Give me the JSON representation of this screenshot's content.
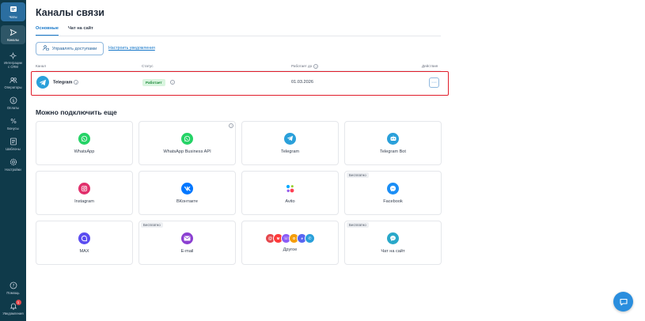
{
  "sidebar": {
    "items": [
      {
        "label": "Чаты",
        "icon": "chat-icon"
      },
      {
        "label": "Каналы",
        "icon": "send-icon"
      },
      {
        "label": "Интеграции\nс CRM",
        "icon": "integration-icon"
      },
      {
        "label": "Операторы",
        "icon": "users-icon"
      },
      {
        "label": "Оплаты",
        "icon": "dollar-icon"
      },
      {
        "label": "Бонусы",
        "icon": "percent-icon"
      },
      {
        "label": "Шаблоны",
        "icon": "template-icon"
      },
      {
        "label": "Настройки",
        "icon": "gear-icon"
      }
    ],
    "bottom": [
      {
        "label": "Помощь",
        "icon": "help-icon"
      },
      {
        "label": "Уведомления",
        "icon": "bell-icon",
        "badge": "1"
      }
    ]
  },
  "page": {
    "title": "Каналы связи"
  },
  "tabs": [
    {
      "label": "Основные",
      "active": true
    },
    {
      "label": "Чат на сайт",
      "active": false
    }
  ],
  "toolbar": {
    "manage_access": "Управлять доступами",
    "notify_settings": "Настроить уведомления"
  },
  "table": {
    "headers": {
      "channel": "Канал",
      "status": "Статус",
      "works_until": "Работает до",
      "actions": "Действия"
    },
    "row": {
      "name": "Telegram",
      "status": "Работает",
      "date": "01.03.2026",
      "more": "···"
    }
  },
  "connect_more": {
    "title": "Можно подключить еще",
    "cards": [
      {
        "label": "WhatsApp",
        "icon": "whatsapp-icon",
        "color": "#25d366"
      },
      {
        "label": "WhatsApp Business API",
        "icon": "whatsapp-icon",
        "color": "#25d366",
        "help": "?"
      },
      {
        "label": "Telegram",
        "icon": "telegram-icon",
        "color": "#2aa0da"
      },
      {
        "label": "Telegram Bot",
        "icon": "telegram-bot-icon",
        "color": "#2aa0da"
      },
      {
        "label": "Instagram",
        "icon": "instagram-icon",
        "color": "#e1306c"
      },
      {
        "label": "ВКонтакте",
        "icon": "vk-icon",
        "color": "#0077ff"
      },
      {
        "label": "Avito",
        "icon": "avito-icon",
        "color": "#97cf26"
      },
      {
        "label": "Facebook",
        "icon": "messenger-icon",
        "color": "#1b8ef5",
        "badge": "Бесплатно"
      },
      {
        "label": "MAX",
        "icon": "max-icon",
        "color": "#5b4cf0"
      },
      {
        "label": "E-mail",
        "icon": "mail-icon",
        "color": "#8b3fd1",
        "badge": "Бесплатно"
      },
      {
        "label": "Другое",
        "icon": "other-icons",
        "color": "#e5484d"
      },
      {
        "label": "Чат на сайт",
        "icon": "site-chat-icon",
        "color": "#29a8c9",
        "badge": "Бесплатно"
      }
    ]
  },
  "colors": {
    "sidebar": "#0f3a4a",
    "accent": "#1677c9",
    "highlight": "#e11d2a",
    "status_ok": "#1f8a3c"
  }
}
